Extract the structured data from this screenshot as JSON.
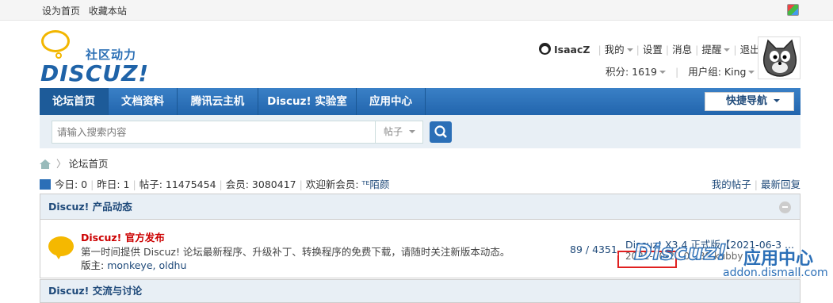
{
  "topbar": {
    "set_home": "设为首页",
    "bookmark": "收藏本站"
  },
  "logo": {
    "cn_text": "社区动力",
    "brand": "DISCUZ!"
  },
  "user": {
    "name": "IsaacZ",
    "my": "我的",
    "settings": "设置",
    "messages": "消息",
    "reminders": "提醒",
    "logout": "退出",
    "points": "积分: 1619",
    "group": "用户组: King"
  },
  "nav": {
    "items": [
      "论坛首页",
      "文档资料",
      "腾讯云主机",
      "Discuz! 实验室",
      "应用中心"
    ],
    "quick": "快捷导航"
  },
  "search": {
    "placeholder": "请输入搜索内容",
    "type": "帖子"
  },
  "breadcrumb": {
    "current": "论坛首页"
  },
  "stats": {
    "today": "今日: 0",
    "yesterday": "昨日: 1",
    "posts": "帖子: 11475454",
    "members": "会员: 3080417",
    "welcome": "欢迎新会员:",
    "new_member": "ᵀᴱ陌颜",
    "my_posts": "我的帖子",
    "latest": "最新回复"
  },
  "categories": [
    {
      "title": "Discuz! 产品动态",
      "forum": {
        "name": "Discuz! 官方发布",
        "desc": "第一时间提供 Discuz! 论坛最新程序、升级补丁、转换程序的免费下载，请随时关注新版本动态。",
        "mod_label": "版主:",
        "mods": "monkeye, oldhu",
        "count": "89 / 4351",
        "last_title": "Discuz! X3.4 正式版【2021-06-3 ...",
        "last_info": "2021-10-20 01:38 kubby"
      }
    },
    {
      "title": "Discuz! 交流与讨论"
    }
  ],
  "watermark": {
    "brand": "Discuz!",
    "label": "应用中心",
    "url": "addon.dismall.com"
  },
  "colors": {
    "primary": "#2b6fb7",
    "forum_name": "#cc0000",
    "highlight": "#e02020"
  }
}
